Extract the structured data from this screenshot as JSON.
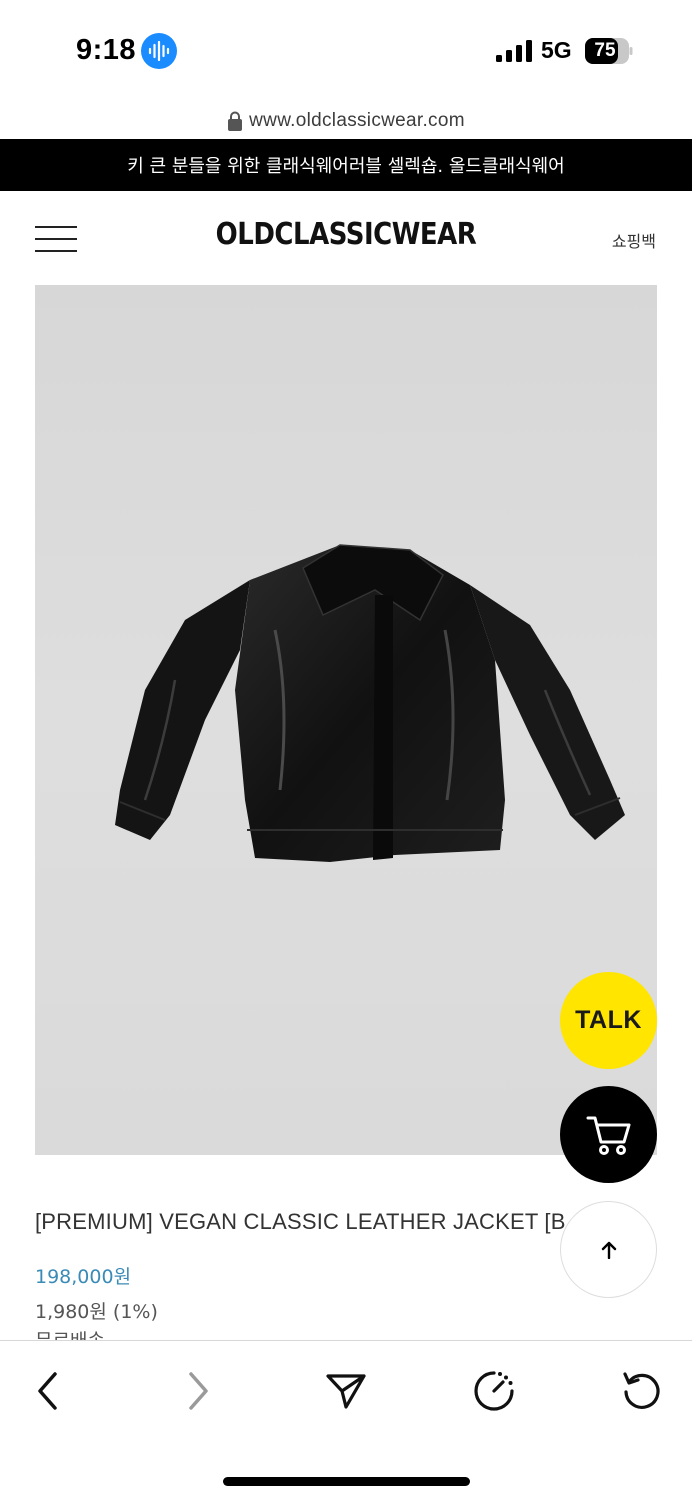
{
  "status_bar": {
    "time": "9:18",
    "network": "5G",
    "battery": "75"
  },
  "browser": {
    "url": "www.oldclassicwear.com"
  },
  "promo_banner": "키 큰 분들을 위한 클래식웨어러블 셀렉숍. 올드클래식웨어",
  "header": {
    "logo": "OLDCLASSICWEAR",
    "bag_label": "쇼핑백"
  },
  "floating": {
    "talk_label": "TALK"
  },
  "product": {
    "name": "[PREMIUM] VEGAN CLASSIC LEATHER JACKET [B",
    "price": "198,000원",
    "points": "1,980원 (1%)",
    "shipping": "무료배송"
  },
  "icons": {
    "siri": "sound-wave-icon",
    "lock": "lock-icon",
    "menu": "hamburger-icon",
    "cart": "cart-icon",
    "top": "arrow-up-icon",
    "back": "chevron-left-icon",
    "forward": "chevron-right-icon",
    "share": "send-icon",
    "speed": "speedometer-icon",
    "reload": "reload-icon"
  },
  "colors": {
    "promo_bg": "#000000",
    "talk_bg": "#ffe500",
    "price": "#3a8bb6",
    "siri": "#1a8cff"
  }
}
